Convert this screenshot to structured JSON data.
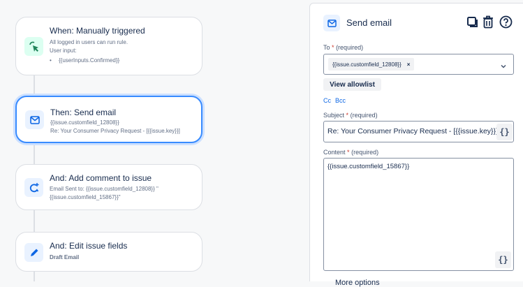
{
  "flow": {
    "cards": [
      {
        "title": "When: Manually triggered",
        "lines": [
          "All logged in users can run rule.",
          "User input:"
        ],
        "bullet": "{{userInputs.Confirmed}}"
      },
      {
        "title": "Then: Send email",
        "lines": [
          "{{issue.customfield_12808}}",
          "Re: Your Consumer Privacy Request - [{{issue.key}}]"
        ]
      },
      {
        "title": "And: Add comment to issue",
        "lines": [
          "Email Sent to: {{issue.customfield_12808}} \"",
          "{{issue.customfield_15867}}\""
        ]
      },
      {
        "title": "And: Edit issue fields",
        "lines": [
          "Draft Email"
        ]
      }
    ]
  },
  "panel": {
    "title": "Send email",
    "to_label": "To",
    "required": "(required)",
    "star": "*",
    "to_value": "{{issue.customfield_12808}}",
    "remove": "×",
    "view_allowlist": "View allowlist",
    "cc": "Cc",
    "bcc": "Bcc",
    "subject_label": "Subject",
    "subject_value": "Re: Your Consumer Privacy Request - [{{issue.key}}]",
    "content_label": "Content",
    "content_value": "{{issue.customfield_15867}}",
    "brace": "{}",
    "more_options": "More options"
  },
  "colors": {
    "accent": "#0c66e4",
    "selected_border": "#388bff",
    "trigger_bg": "#dcfff1",
    "trigger_icon": "#1f845a"
  }
}
